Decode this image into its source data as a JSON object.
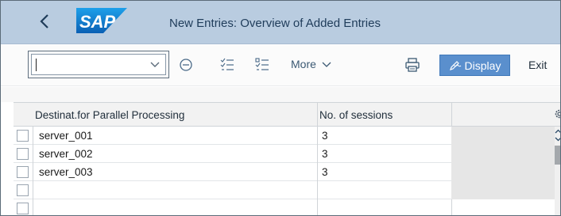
{
  "window": {
    "title": "New Entries: Overview of Added Entries",
    "logo_text": "SAP"
  },
  "toolbar": {
    "command_value": "",
    "more_label": "More",
    "display_label": "Display",
    "exit_label": "Exit"
  },
  "table": {
    "columns": [
      "Destinat.for Parallel Processing",
      "No. of sessions"
    ],
    "rows": [
      {
        "destination": "server_001",
        "sessions": "3"
      },
      {
        "destination": "server_002",
        "sessions": "3"
      },
      {
        "destination": "server_003",
        "sessions": "3"
      },
      {
        "destination": "",
        "sessions": ""
      }
    ]
  },
  "colors": {
    "titlebar": "#b9cce0",
    "accent": "#5a8fcd",
    "sap_blue": "#0a73c8"
  },
  "icons": [
    "back-icon",
    "sap-logo",
    "dropdown-icon",
    "minus-circle-icon",
    "expand-list-icon",
    "collapse-list-icon",
    "chevron-down-icon",
    "print-icon",
    "display-pencil-icon",
    "settings-icon"
  ]
}
